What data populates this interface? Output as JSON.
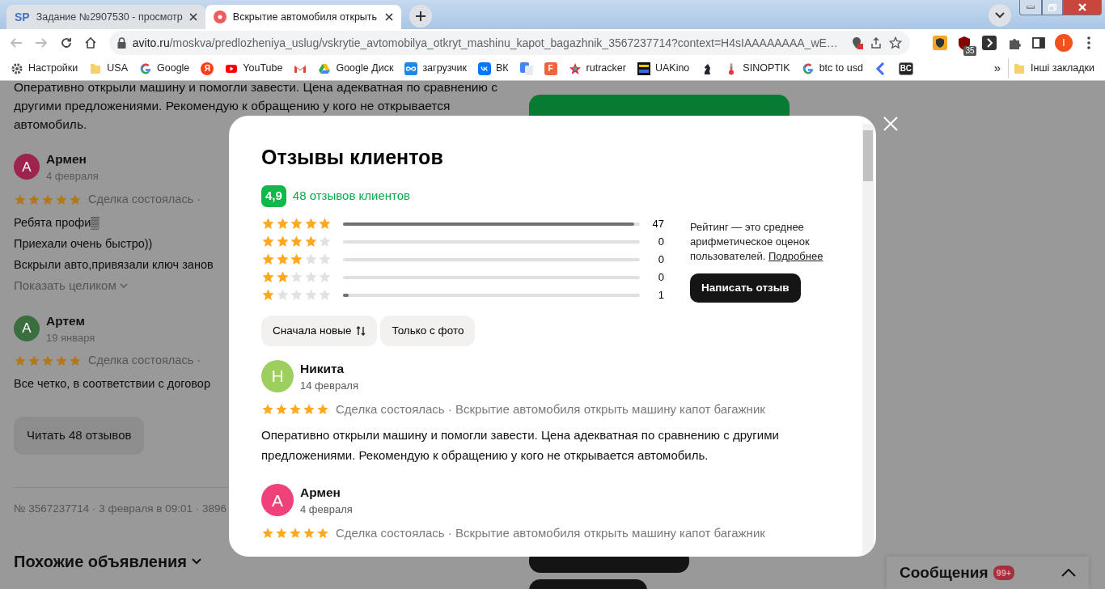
{
  "browser": {
    "tabs": [
      {
        "favicon_text": "SP",
        "title": "Задание №2907530 - просмотр",
        "selected": false
      },
      {
        "title": "Вскрытие автомобиля открыть",
        "selected": true
      }
    ],
    "address": {
      "domain": "avito.ru",
      "path": "/moskva/predlozheniya_uslug/vskrytie_avtomobilya_otkryt_mashinu_kapot_bagazhnik_3567237714?context=H4sIAAAAAAAA_wE…"
    },
    "extensions": [
      {
        "kind": "shield"
      },
      {
        "kind": "ublock",
        "badge": "35"
      },
      {
        "kind": "bracket"
      },
      {
        "kind": "puzzle"
      },
      {
        "kind": "panel"
      }
    ],
    "profile_letter": "I",
    "bookmarks": [
      {
        "kind": "gear",
        "label": "Настройки"
      },
      {
        "kind": "folder",
        "label": "USA"
      },
      {
        "kind": "google",
        "label": "Google"
      },
      {
        "kind": "letter",
        "icon_text": "Я",
        "color": "#fc3f1d"
      },
      {
        "kind": "youtube",
        "label": "YouTube"
      },
      {
        "kind": "gmail"
      },
      {
        "kind": "drive",
        "label": "Google Диск"
      },
      {
        "kind": "infinity",
        "label": "загрузчик"
      },
      {
        "kind": "vk",
        "label": "ВК"
      },
      {
        "kind": "translate"
      },
      {
        "kind": "letter",
        "icon_text": "F",
        "color": "#f0643c"
      },
      {
        "kind": "star",
        "label": "rutracker"
      },
      {
        "kind": "film",
        "label": "UAKino"
      },
      {
        "kind": "knight"
      },
      {
        "kind": "thermo",
        "label": "SINOPTIK"
      },
      {
        "kind": "google",
        "label": "btc to usd"
      },
      {
        "kind": "chevron"
      },
      {
        "kind": "letter",
        "icon_text": "BC",
        "color": "#222222"
      }
    ],
    "bookmarks_more": "»",
    "other_bookmarks": "Інші закладки"
  },
  "page": {
    "intro_text": "Оперативно открыли машину и помогли завести. Цена адекватная по сравнению с другими предложениями. Рекомендую к обращению у кого не открывается автомобиль.",
    "reviews": [
      {
        "letter": "А",
        "color": "#9e2450",
        "name": "Армен",
        "date": "4 февраля",
        "stars": 5,
        "deal": "Сделка состоялась ·",
        "lines": [
          "Ребята профи▒",
          "Приехали очень быстро))",
          "Вскрыли авто,привязали ключ занов"
        ],
        "expand": "Показать целиком"
      },
      {
        "letter": "А",
        "color": "#3b6e3e",
        "name": "Артем",
        "date": "19 января",
        "stars": 5,
        "deal": "Сделка состоялась ·",
        "lines": [
          "Все четко, в соответствии с договор"
        ]
      }
    ],
    "read_all": "Читать 48 отзывов",
    "footer": "№ 3567237714 · 3 февраля в 09:01 · 3896",
    "similar": "Похожие объявления"
  },
  "modal": {
    "title": "Отзывы клиентов",
    "score": "4,9",
    "count_link": "48 отзывов клиентов",
    "distribution": [
      {
        "stars": 5,
        "level": 0.98,
        "count": "47"
      },
      {
        "stars": 4,
        "count": "0"
      },
      {
        "stars": 3,
        "count": "0"
      },
      {
        "stars": 2,
        "count": "0"
      },
      {
        "stars": 1,
        "level": 0.02,
        "count": "1"
      }
    ],
    "info": "Рейтинг — это среднее арифметическое оценок пользователей.",
    "info_link": "Подробнее",
    "write_button": "Написать отзыв",
    "filters": [
      {
        "kind": "sort",
        "label": "Сначала новые"
      },
      {
        "kind": "plain",
        "label": "Только с фото"
      }
    ],
    "reviews": [
      {
        "letter": "Н",
        "color": "#9ccf5e",
        "name": "Никита",
        "date": "14 февраля",
        "stars": 5,
        "deal": "Сделка состоялась · Вскрытие автомобиля открыть машину капот багажник",
        "text": "Оперативно открыли машину и помогли завести. Цена адекватная по сравнению с другими предложениями. Рекомендую к обращению у кого не открывается автомобиль."
      },
      {
        "letter": "А",
        "color": "#f0417a",
        "name": "Армен",
        "date": "4 февраля",
        "stars": 5,
        "deal": "Сделка состоялась · Вскрытие автомобиля открыть машину капот багажник"
      }
    ]
  },
  "messages": {
    "label": "Сообщения",
    "badge": "99+"
  }
}
